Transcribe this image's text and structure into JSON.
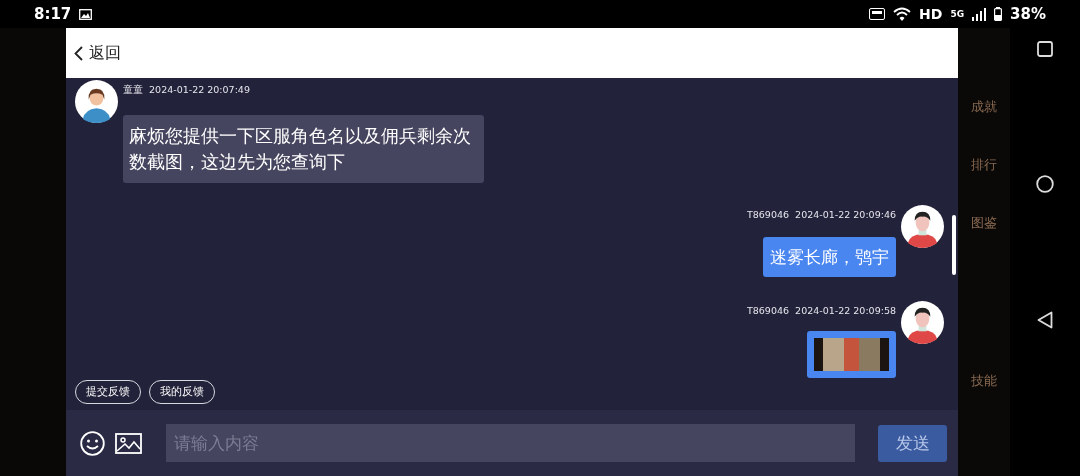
{
  "status_bar": {
    "time": "8:17",
    "hd_label": "HD",
    "network_type": "5G",
    "battery": "38%"
  },
  "header": {
    "back_label": "返回"
  },
  "messages": [
    {
      "kind": "agent_text",
      "sender": "童童",
      "time": "2024-01-22 20:07:49",
      "text": "麻烦您提供一下区服角色名以及佣兵剩余次数截图，这边先为您查询下"
    },
    {
      "kind": "user_text",
      "sender": "T869046",
      "time": "2024-01-22 20:09:46",
      "text": "迷雾长廊，鸮宇"
    },
    {
      "kind": "user_image",
      "sender": "T869046",
      "time": "2024-01-22 20:09:58"
    }
  ],
  "feedback_buttons": [
    "提交反馈",
    "我的反馈"
  ],
  "composer": {
    "placeholder": "请输入内容",
    "send_label": "发送"
  },
  "background_labels": [
    "成就",
    "排行",
    "图鉴",
    "技能"
  ]
}
